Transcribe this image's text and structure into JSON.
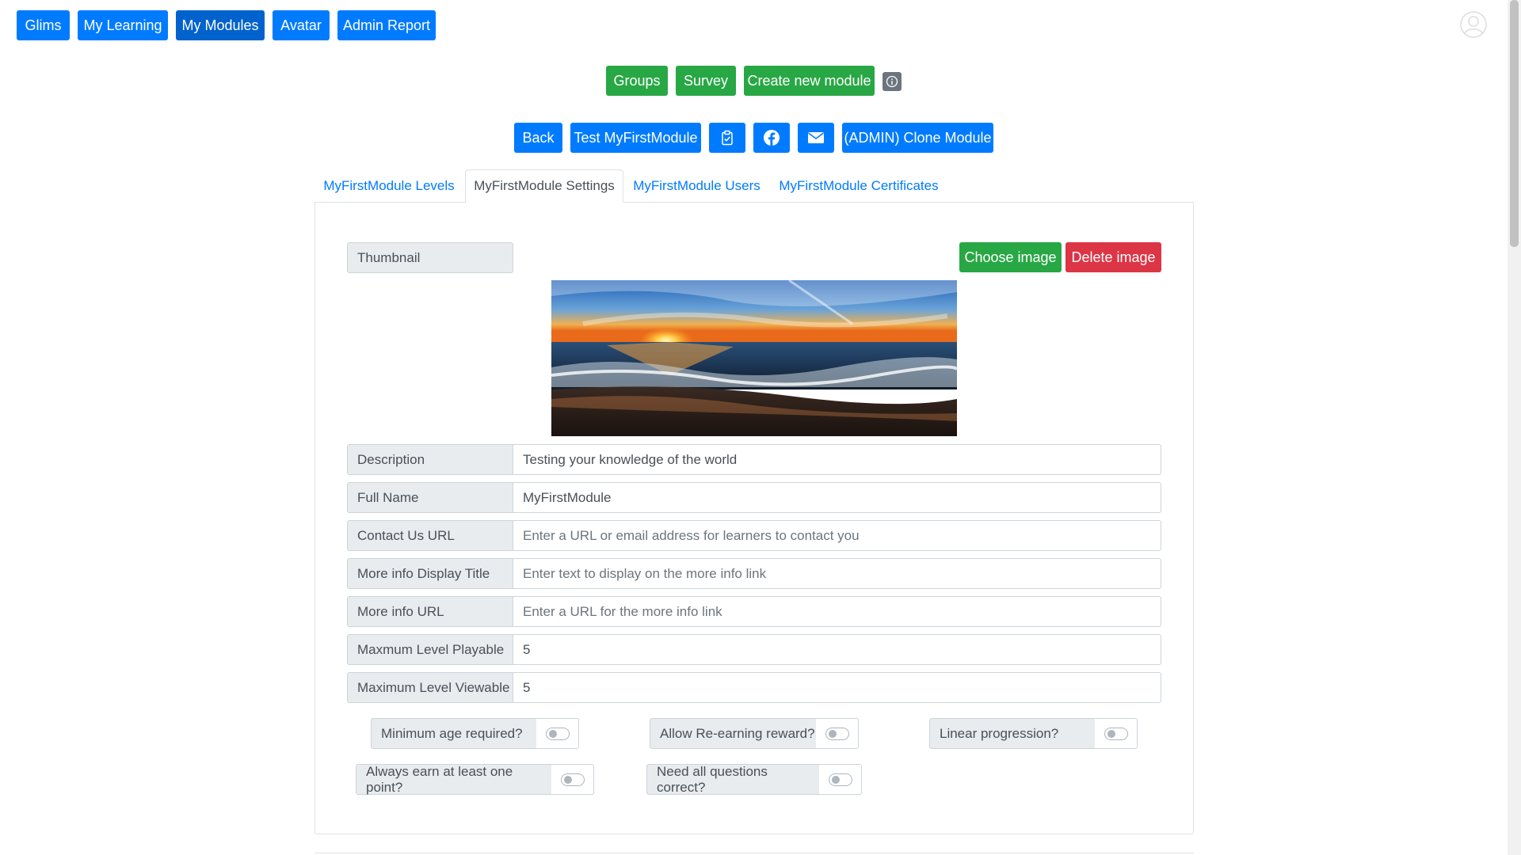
{
  "nav": {
    "glims": "Glims",
    "my_learning": "My Learning",
    "my_modules": "My Modules",
    "avatar": "Avatar",
    "admin_report": "Admin Report"
  },
  "toolbar1": {
    "groups": "Groups",
    "survey": "Survey",
    "create_new_module": "Create new module",
    "info_icon": "info-icon"
  },
  "toolbar2": {
    "back": "Back",
    "test_module": "Test MyFirstModule",
    "clipboard_icon": "clipboard-check-icon",
    "facebook_icon": "facebook-icon",
    "email_icon": "envelope-icon",
    "clone_module": "(ADMIN) Clone Module"
  },
  "tabs": [
    {
      "label": "MyFirstModule Levels",
      "active": false
    },
    {
      "label": "MyFirstModule Settings",
      "active": true
    },
    {
      "label": "MyFirstModule Users",
      "active": false
    },
    {
      "label": "MyFirstModule Certificates",
      "active": false
    }
  ],
  "settings": {
    "thumbnail_label": "Thumbnail",
    "choose_image": "Choose image",
    "delete_image": "Delete image",
    "fields": [
      {
        "label": "Description",
        "value": "Testing your knowledge of the world",
        "placeholder": ""
      },
      {
        "label": "Full Name",
        "value": "MyFirstModule",
        "placeholder": ""
      },
      {
        "label": "Contact Us URL",
        "value": "",
        "placeholder": "Enter a URL or email address for learners to contact you"
      },
      {
        "label": "More info Display Title",
        "value": "",
        "placeholder": "Enter text to display on the more info link"
      },
      {
        "label": "More info URL",
        "value": "",
        "placeholder": "Enter a URL for the more info link"
      },
      {
        "label": "Maxmum Level Playable",
        "value": "5",
        "placeholder": ""
      },
      {
        "label": "Maximum Level Viewable",
        "value": "5",
        "placeholder": ""
      }
    ],
    "toggles": [
      {
        "label": "Minimum age required?",
        "checked": false
      },
      {
        "label": "Allow Re-earning reward?",
        "checked": false
      },
      {
        "label": "Linear progression?",
        "checked": false
      },
      {
        "label": "Always earn at least one point?",
        "checked": false
      },
      {
        "label": "Need all questions correct?",
        "checked": false
      }
    ]
  },
  "colors": {
    "primary": "#007bff",
    "success": "#28a745",
    "danger": "#dc3545",
    "secondary": "#6c757d"
  }
}
